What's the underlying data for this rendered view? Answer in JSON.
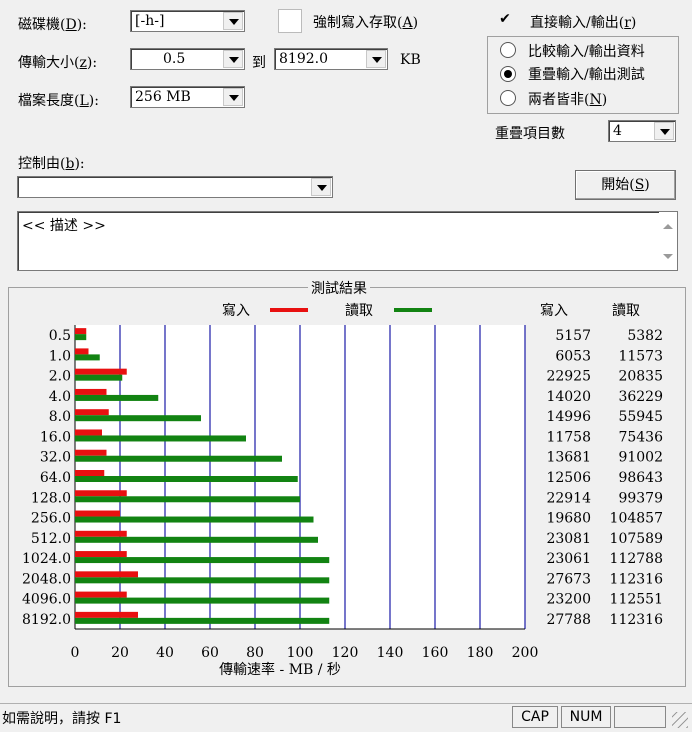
{
  "controls": {
    "drive_label": "磁碟機(",
    "drive_key": "D",
    "drive_label_end": "):",
    "drive_value": "[-h-]",
    "force_write_label": "強制寫入存取(",
    "force_write_key": "A",
    "force_write_end": ")",
    "direct_io_label": "直接輸入/輸出(",
    "direct_io_key": "r",
    "direct_io_end": ")",
    "direct_io_check": "✔",
    "transfer_label": "傳輸大小(",
    "transfer_key": "z",
    "transfer_end": "):",
    "transfer_from": "0.5",
    "to_label": "到",
    "transfer_to": "8192.0",
    "unit": "KB",
    "file_len_label": "檔案長度(",
    "file_len_key": "L",
    "file_len_end": "):",
    "file_len_value": "256 MB",
    "radio_compare": "比較輸入/輸出資料",
    "radio_overlap": "重疊輸入/輸出測試",
    "radio_neither_a": "兩者皆非(",
    "radio_neither_key": "N",
    "radio_neither_b": ")",
    "queue_label": "重疊項目數",
    "queue_value": "4",
    "control_by_label": "控制由(",
    "control_by_key": "b",
    "control_by_end": "):",
    "control_by_value": "",
    "start_label": "開始(",
    "start_key": "S",
    "start_end": ")",
    "description": "<< 描述 >>"
  },
  "results": {
    "group_title": "測試結果",
    "legend_write": "寫入",
    "legend_read": "讀取",
    "col_write": "寫入",
    "col_read": "讀取"
  },
  "colors": {
    "write": "#e81010",
    "read": "#128312",
    "grid": "#1a1aa8"
  },
  "chart_data": {
    "type": "bar",
    "orientation": "horizontal",
    "categories": [
      "0.5",
      "1.0",
      "2.0",
      "4.0",
      "8.0",
      "16.0",
      "32.0",
      "64.0",
      "128.0",
      "256.0",
      "512.0",
      "1024.0",
      "2048.0",
      "4096.0",
      "8192.0"
    ],
    "series": [
      {
        "name": "寫入",
        "values": [
          5,
          6,
          23,
          14,
          15,
          12,
          14,
          13,
          23,
          20,
          23,
          23,
          28,
          23,
          28
        ]
      },
      {
        "name": "讀取",
        "values": [
          5,
          11,
          21,
          37,
          56,
          76,
          92,
          99,
          100,
          106,
          108,
          113,
          113,
          113,
          113
        ]
      }
    ],
    "table_write": [
      5157,
      6053,
      22925,
      14020,
      14996,
      11758,
      13681,
      12506,
      22914,
      19680,
      23081,
      23061,
      27673,
      23200,
      27788
    ],
    "table_read": [
      5382,
      11573,
      20835,
      36229,
      55945,
      75436,
      91002,
      98643,
      99379,
      104857,
      107589,
      112788,
      112316,
      112551,
      112316
    ],
    "xticks": [
      0,
      20,
      40,
      60,
      80,
      100,
      120,
      140,
      160,
      180,
      200
    ],
    "xlim": [
      0,
      200
    ],
    "xlabel": "傳輸速率 - MB / 秒",
    "grid": true
  },
  "status": {
    "help": "如需說明，請按 F1",
    "cap": "CAP",
    "num": "NUM",
    "blank": ""
  }
}
